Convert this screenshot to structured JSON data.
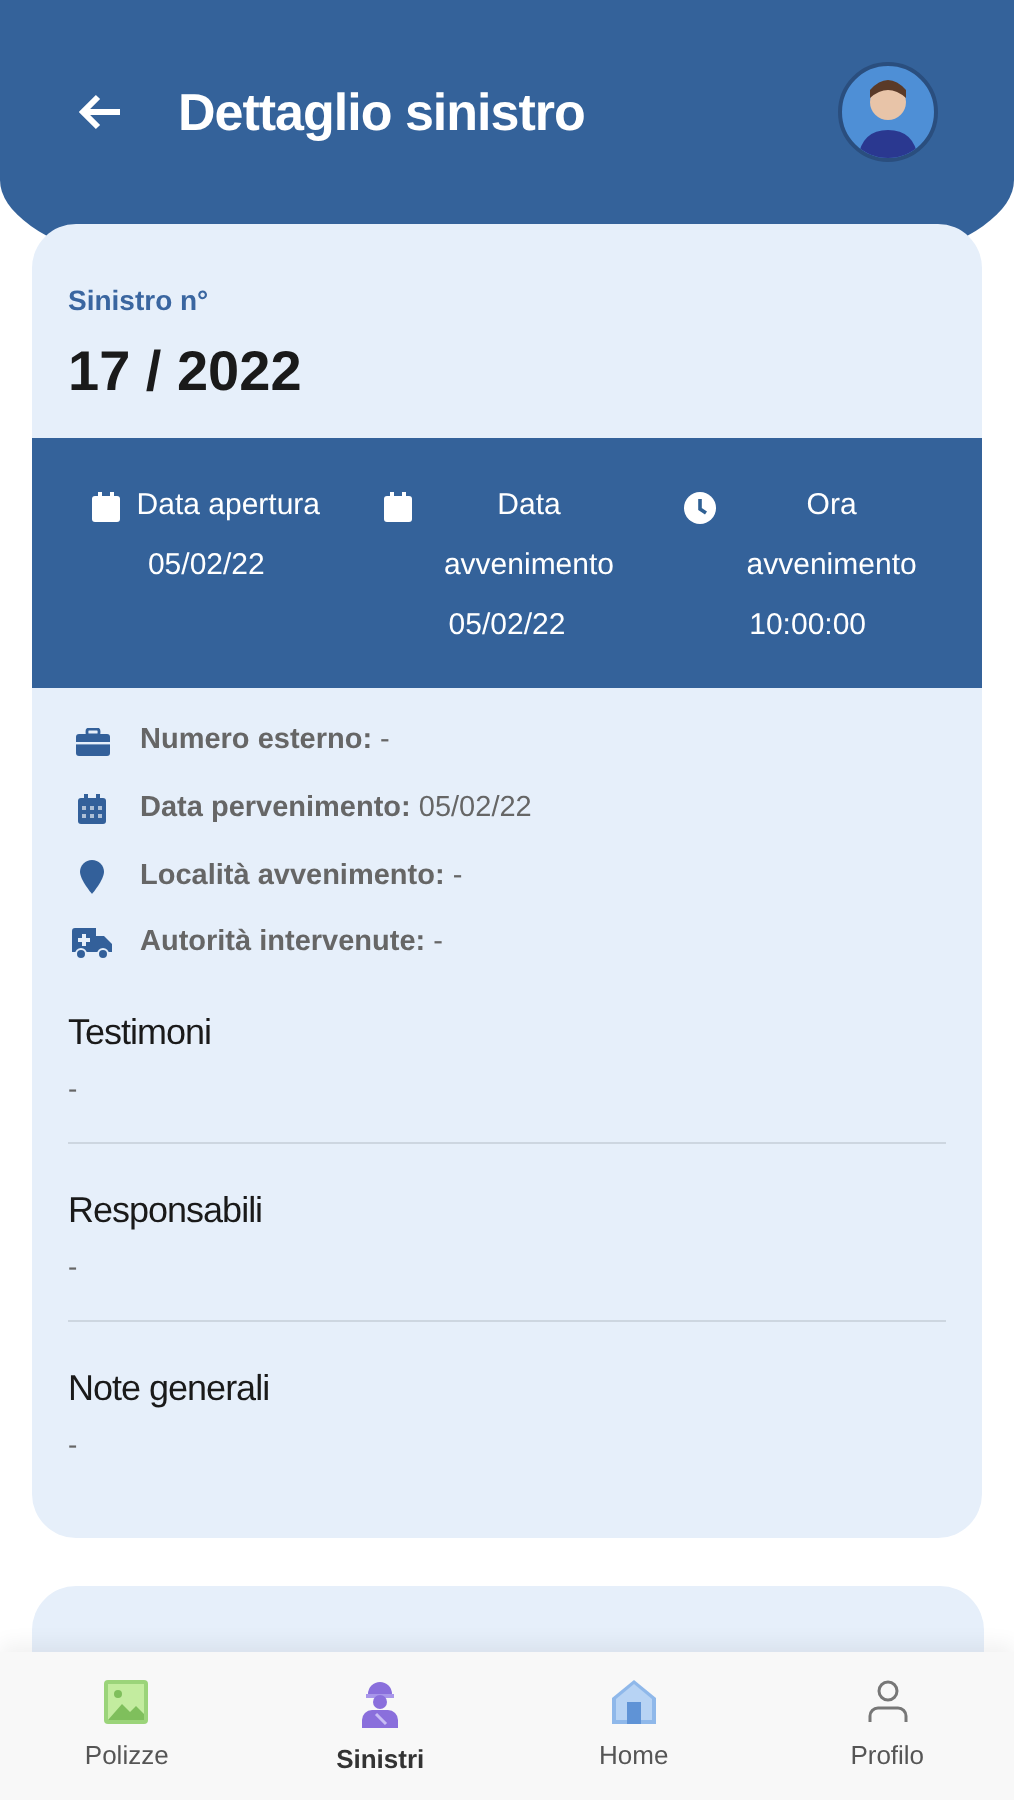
{
  "header": {
    "title": "Dettaglio sinistro"
  },
  "claim": {
    "label": "Sinistro n°",
    "number": "17 / 2022"
  },
  "summary": [
    {
      "kind": "calendar",
      "label": "Data apertura",
      "value": "05/02/22"
    },
    {
      "kind": "calendar",
      "label": "Data avvenimento",
      "value": "05/02/22"
    },
    {
      "kind": "clock",
      "label": "Ora avvenimento",
      "value": "10:00:00"
    }
  ],
  "details": [
    {
      "kind": "briefcase",
      "text": "**Numero esterno:** -"
    },
    {
      "kind": "calendar",
      "text": "**Data pervenimento:** 05/02/22"
    },
    {
      "kind": "pin",
      "text": "**Località avvenimento:** -"
    },
    {
      "kind": "ambulance",
      "text": "**Autorità intervenute:** -"
    }
  ],
  "sections": [
    {
      "title": "Testimoni",
      "value": "-"
    },
    {
      "title": "Responsabili",
      "value": "-"
    },
    {
      "title": "Note generali",
      "value": "-"
    }
  ],
  "nav": [
    {
      "kind": "image",
      "label": "Polizze",
      "selected": false
    },
    {
      "kind": "worker",
      "label": "Sinistri",
      "selected": true
    },
    {
      "kind": "home",
      "label": "Home",
      "selected": false
    },
    {
      "kind": "person",
      "label": "Profilo",
      "selected": false
    }
  ]
}
